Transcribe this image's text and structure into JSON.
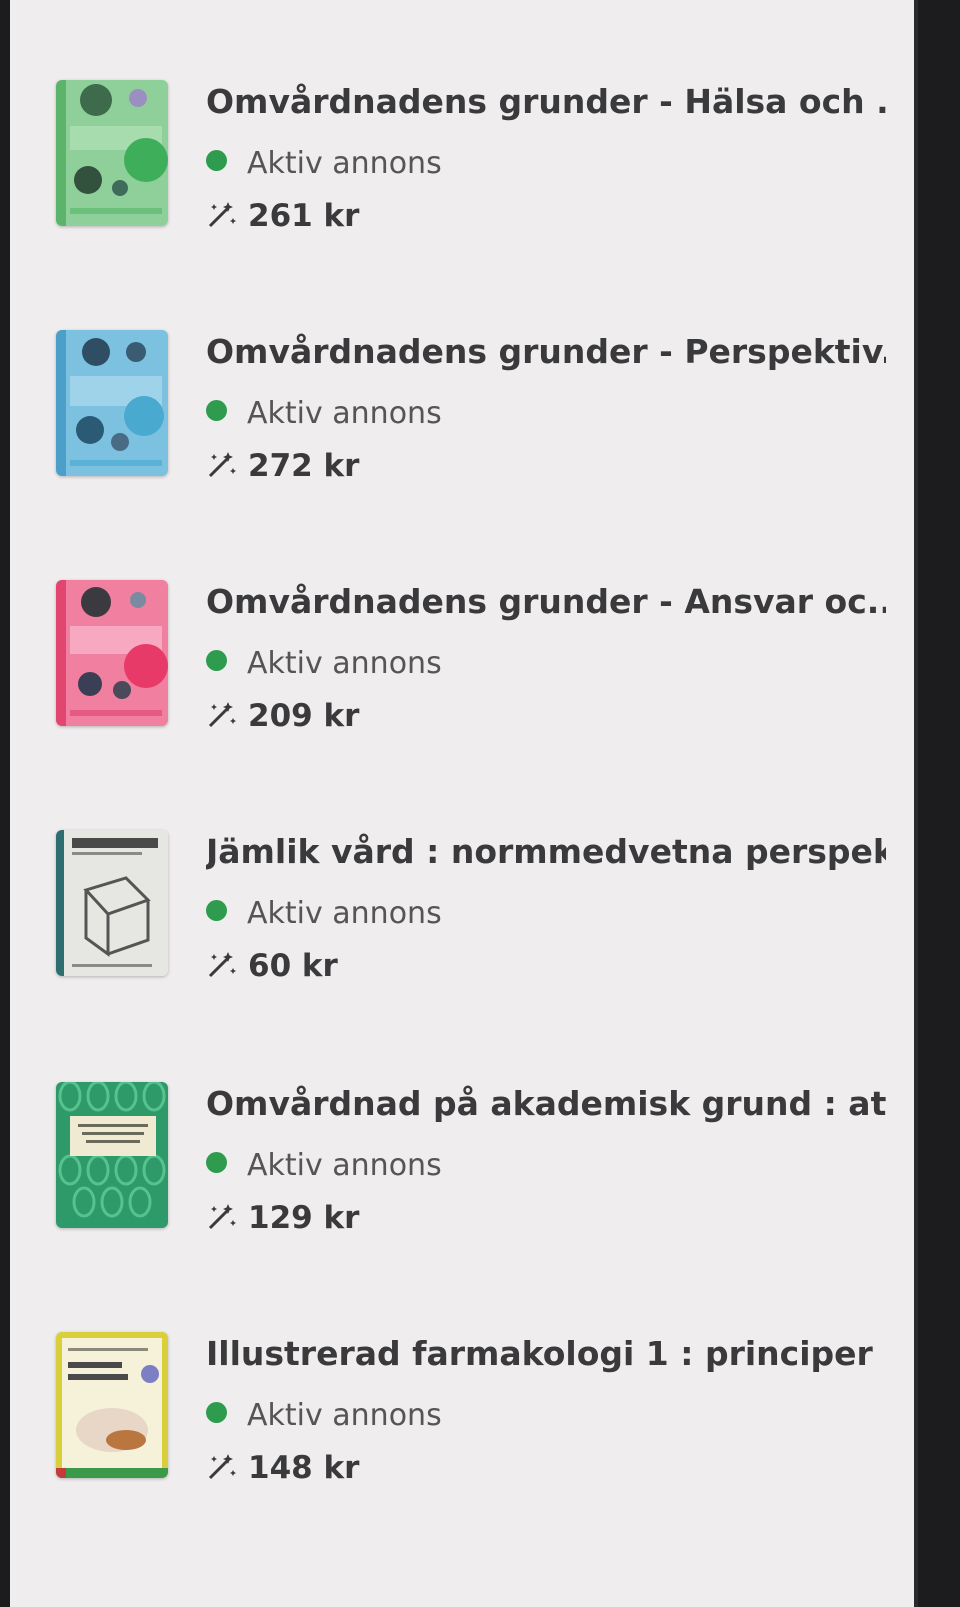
{
  "listings": [
    {
      "title": "Omvårdnadens grunder - Hälsa och ...",
      "status": "Aktiv annons",
      "price": "261 kr",
      "cover_color": "#6fbf7a",
      "cover_icon": "book-cover-green"
    },
    {
      "title": "Omvårdnadens grunder - Perspektiv...",
      "status": "Aktiv annons",
      "price": "272 kr",
      "cover_color": "#5aa9cf",
      "cover_icon": "book-cover-blue"
    },
    {
      "title": "Omvårdnadens grunder - Ansvar oc...",
      "status": "Aktiv annons",
      "price": "209 kr",
      "cover_color": "#e94f7c",
      "cover_icon": "book-cover-pink"
    },
    {
      "title": "Jämlik vård : normmedvetna perspek...",
      "status": "Aktiv annons",
      "price": "60 kr",
      "cover_color": "#e6e6e2",
      "cover_icon": "book-cover-sketch"
    },
    {
      "title": "Omvårdnad på akademisk grund : at...",
      "status": "Aktiv annons",
      "price": "129 kr",
      "cover_color": "#2e9a6a",
      "cover_icon": "book-cover-leaf-pattern"
    },
    {
      "title": "Illustrerad farmakologi 1 : principer ...",
      "status": "Aktiv annons",
      "price": "148 kr",
      "cover_color": "#f2f0d8",
      "cover_icon": "book-cover-pharma"
    }
  ],
  "theme": {
    "status_dot_color": "#2e9b4e",
    "text_color": "#3a3a3c",
    "background": "#efeded"
  },
  "icons": {
    "status": "green-dot-icon",
    "price": "magic-wand-icon"
  }
}
